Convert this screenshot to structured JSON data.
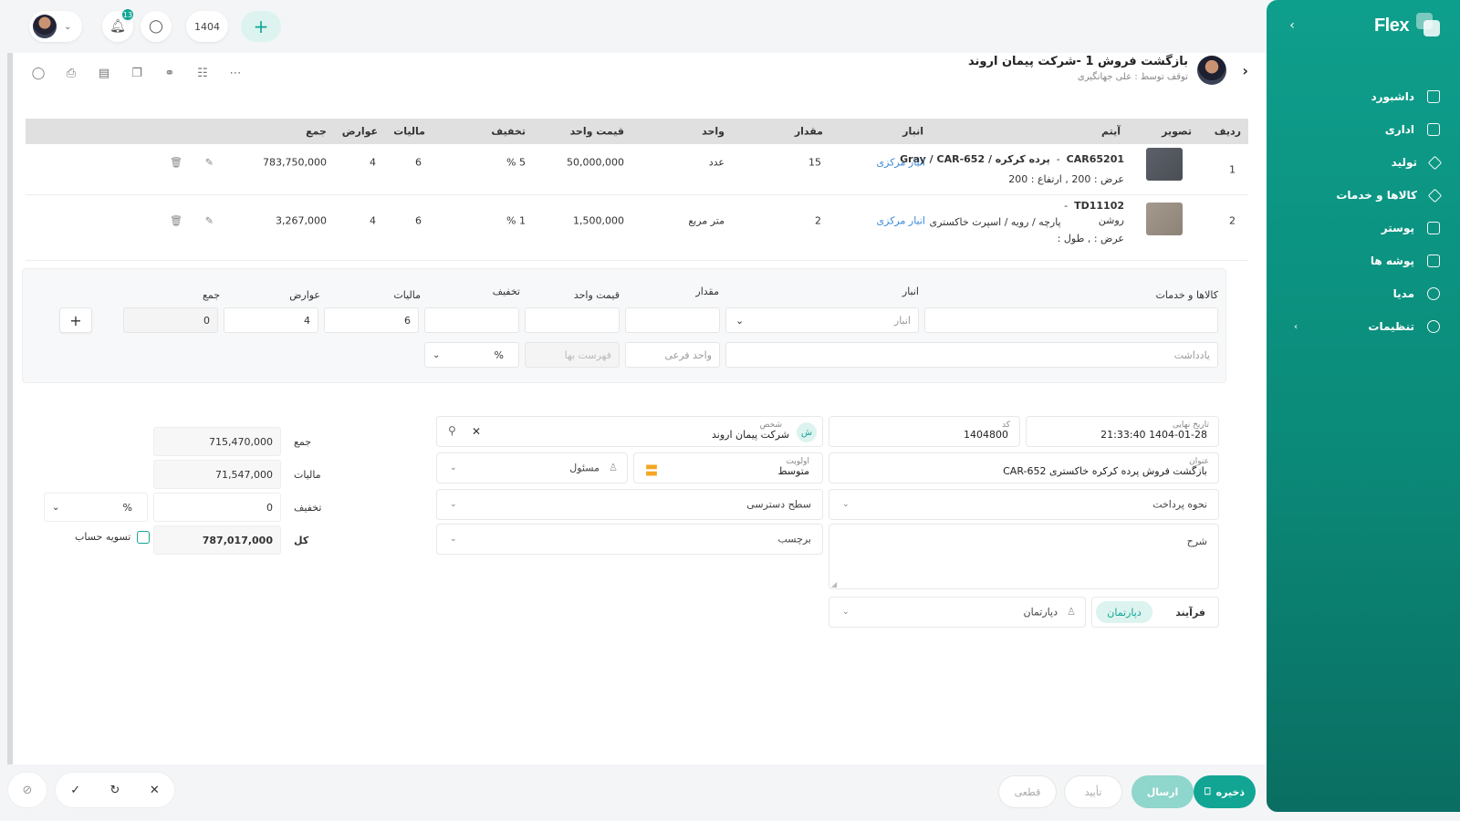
{
  "sidebar": {
    "logo": "Flex",
    "items": [
      {
        "label": "داشبورد",
        "icon": "home-icon"
      },
      {
        "label": "اداری",
        "icon": "inbox-icon"
      },
      {
        "label": "تولید",
        "icon": "wrench-icon"
      },
      {
        "label": "کالاها و خدمات",
        "icon": "box-icon"
      },
      {
        "label": "پوستر",
        "icon": "image-icon"
      },
      {
        "label": "پوشه ها",
        "icon": "folder-icon"
      },
      {
        "label": "مدیا",
        "icon": "media-icon"
      },
      {
        "label": "تنظیمات",
        "icon": "gear-icon"
      }
    ]
  },
  "topbar": {
    "notification_count": "13",
    "year": "1404",
    "add_label": "+"
  },
  "header": {
    "title": "بازگشت فروش 1 -شرکت پیمان اروند",
    "subtitle": "توقف توسط : علی جهانگیری"
  },
  "table": {
    "headers": {
      "row": "ردیف",
      "image": "تصویر",
      "item": "آیتم",
      "warehouse": "انبار",
      "qty": "مقدار",
      "unit": "واحد",
      "unit_price": "قیمت واحد",
      "discount": "تخفیف",
      "tax": "مالیات",
      "duties": "عوارض",
      "total": "جمع"
    },
    "rows": [
      {
        "row": "1",
        "code": "CAR65201",
        "name": "پرده کرکره / Gray / CAR-652",
        "detail": "عرض : 200 ,  ارتفاع : 200",
        "warehouse": "انبار مرکزی",
        "qty": "15",
        "unit": "عدد",
        "unit_price": "50,000,000",
        "discount": "5 %",
        "tax": "6",
        "duties": "4",
        "total": "783,750,000"
      },
      {
        "row": "2",
        "code": "TD11102",
        "name": "پارچه / رویه / اسپرت خاکستری",
        "name2": "روشن",
        "detail": "عرض : ,  طول :",
        "warehouse": "انبار مرکزی",
        "qty": "2",
        "unit": "متر مربع",
        "unit_price": "1,500,000",
        "discount": "1 %",
        "tax": "6",
        "duties": "4",
        "total": "3,267,000"
      }
    ]
  },
  "add_row": {
    "goods_label": "کالاها و خدمات",
    "warehouse_label": "انبار",
    "warehouse_placeholder": "انبار",
    "qty_label": "مقدار",
    "unit_price_label": "قیمت واحد",
    "discount_label": "تخفیف",
    "tax_label": "مالیات",
    "tax_value": "6",
    "duties_label": "عوارض",
    "duties_value": "4",
    "total_label": "جمع",
    "total_value": "0",
    "note_placeholder": "یادداشت",
    "sub_unit_placeholder": "واحد فرعی",
    "price_list_placeholder": "فهرست بها",
    "discount_type": "%"
  },
  "form": {
    "final_date_label": "تاریخ نهایی",
    "final_date": "1404-01-28 21:33:40",
    "code_label": "کد",
    "code": "1404800",
    "person_label": "شخص",
    "person": "شرکت پیمان اروند",
    "person_initial": "ش",
    "title_label": "عنوان",
    "title": "بازگشت فروش پرده کرکره خاکستری CAR-652",
    "priority_label": "اولویت",
    "priority": "متوسط",
    "responsible": "مسئول",
    "payment_method": "نحوه پرداخت",
    "access_level": "سطح دسترسی",
    "description": "شرح",
    "tag": "برچسب",
    "process": "فرآیند",
    "department_tab": "دپارتمان",
    "department_placeholder": "دپارتمان"
  },
  "totals": {
    "sum_label": "جمع",
    "sum": "715,470,000",
    "tax_label": "مالیات",
    "tax": "71,547,000",
    "discount_label": "تخفیف",
    "discount": "0",
    "discount_type": "%",
    "total_label": "کل",
    "total": "787,017,000",
    "settle_label": "تسویه حساب"
  },
  "footer": {
    "save": "ذخیره",
    "send": "ارسال",
    "confirm": "تأیید",
    "final": "قطعی"
  },
  "colors": {
    "accent": "#12a594",
    "sidebar": "#0e9f8c",
    "link": "#3a88d8"
  }
}
